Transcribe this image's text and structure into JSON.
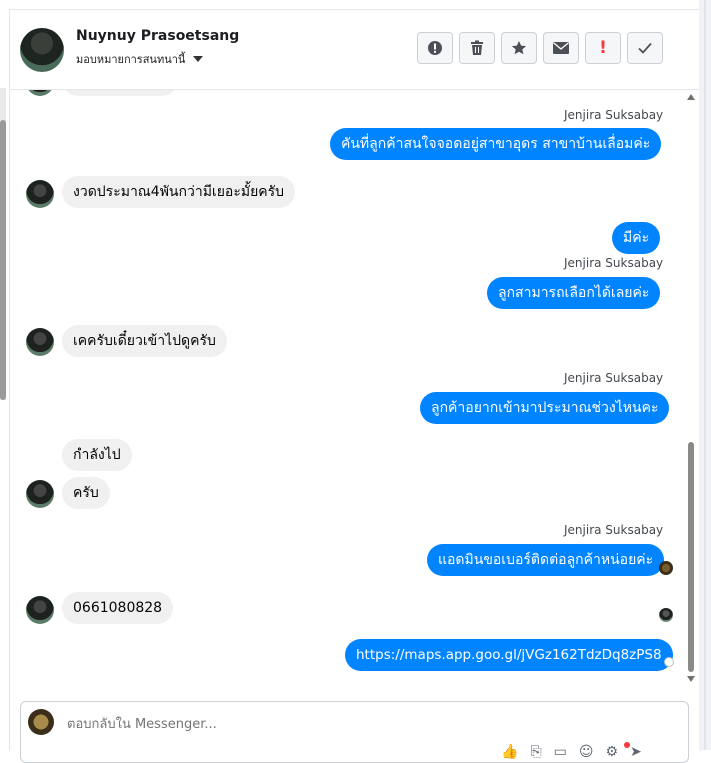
{
  "header": {
    "name": "Nuynuy Prasoetsang",
    "assign_label": "มอบหมายการสนทนานี้",
    "toolbar": [
      {
        "icon": "alert-icon",
        "glyph": "⚠"
      },
      {
        "icon": "trash-icon",
        "glyph": "🗑"
      },
      {
        "icon": "star-icon",
        "glyph": "★"
      },
      {
        "icon": "envelope-icon",
        "glyph": "✉"
      },
      {
        "icon": "exclamation-icon",
        "glyph": "!"
      },
      {
        "icon": "check-icon",
        "glyph": "✓"
      }
    ]
  },
  "messages": {
    "m1_sender": "Jenjira Suksabay",
    "m1_text": "คันที่ลูกค้าสนใจจอดอยู่สาขาอุดร สาขาบ้านเลื่อมค่ะ",
    "m2_text": "งวดประมาณ4พันกว่ามีเยอะมั้ยครับ",
    "m3_text": "มีค่ะ",
    "m4_sender": "Jenjira Suksabay",
    "m4_text": "ลูกสามารถเลือกได้เลยค่ะ",
    "m5_text": "เคครับเดี๋ยวเข้าไปดูครับ",
    "m6_sender": "Jenjira Suksabay",
    "m6_text": "ลูกค้าอยากเข้ามาประมาณช่วงไหนคะ",
    "m7_text": "กำลังไป",
    "m8_text": "ครับ",
    "m9_sender": "Jenjira Suksabay",
    "m9_text": "แอดมินขอเบอร์ติดต่อลูกค้าหน่อยค่ะ",
    "m10_text": "0661080828",
    "m11_text": "https://maps.app.goo.gl/jVGz162TdzDq8zPS8"
  },
  "composer": {
    "placeholder": "ตอบกลับใน Messenger..."
  },
  "colors": {
    "outgoing_bubble": "#0084ff",
    "incoming_bubble": "#f0f0f0",
    "alert_red": "#fa383e"
  }
}
